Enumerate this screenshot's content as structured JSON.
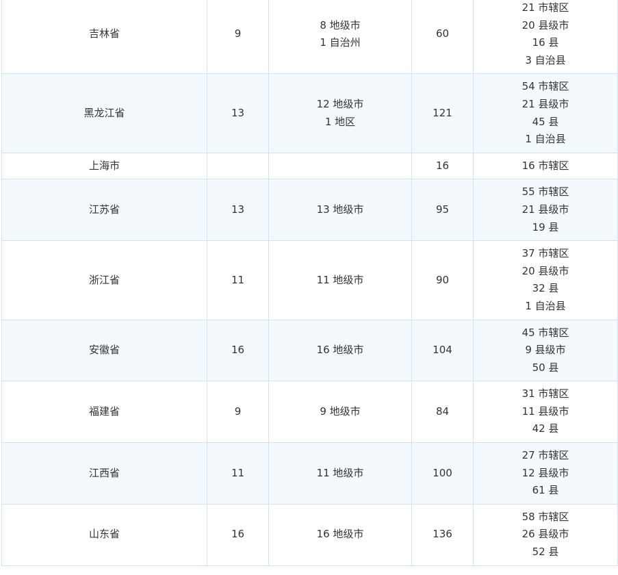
{
  "table": {
    "rows": [
      {
        "province": "吉林省",
        "prefecture_count": "9",
        "prefecture_types": [
          "8 地级市",
          "1 自治州"
        ],
        "county_count": "60",
        "county_types": [
          "21 市辖区",
          "20 县级市",
          "16 县",
          "3 自治县"
        ]
      },
      {
        "province": "黑龙江省",
        "prefecture_count": "13",
        "prefecture_types": [
          "12 地级市",
          "1 地区"
        ],
        "county_count": "121",
        "county_types": [
          "54 市辖区",
          "21 县级市",
          "45 县",
          "1 自治县"
        ]
      },
      {
        "province": "上海市",
        "prefecture_count": "",
        "prefecture_types": [],
        "county_count": "16",
        "county_types": [
          "16 市辖区"
        ]
      },
      {
        "province": "江苏省",
        "prefecture_count": "13",
        "prefecture_types": [
          "13 地级市"
        ],
        "county_count": "95",
        "county_types": [
          "55 市辖区",
          "21 县级市",
          "19 县"
        ]
      },
      {
        "province": "浙江省",
        "prefecture_count": "11",
        "prefecture_types": [
          "11 地级市"
        ],
        "county_count": "90",
        "county_types": [
          "37 市辖区",
          "20 县级市",
          "32 县",
          "1 自治县"
        ]
      },
      {
        "province": "安徽省",
        "prefecture_count": "16",
        "prefecture_types": [
          "16 地级市"
        ],
        "county_count": "104",
        "county_types": [
          "45 市辖区",
          "9 县级市",
          "50 县"
        ]
      },
      {
        "province": "福建省",
        "prefecture_count": "9",
        "prefecture_types": [
          "9 地级市"
        ],
        "county_count": "84",
        "county_types": [
          "31 市辖区",
          "11 县级市",
          "42 县"
        ]
      },
      {
        "province": "江西省",
        "prefecture_count": "11",
        "prefecture_types": [
          "11 地级市"
        ],
        "county_count": "100",
        "county_types": [
          "27 市辖区",
          "12 县级市",
          "61 县"
        ]
      },
      {
        "province": "山东省",
        "prefecture_count": "16",
        "prefecture_types": [
          "16 地级市"
        ],
        "county_count": "136",
        "county_types": [
          "58 市辖区",
          "26 县级市",
          "52 县"
        ]
      }
    ]
  },
  "colors": {
    "border": "#cfe3f3",
    "row_alt_background": "#f4f9fd",
    "text": "#333333"
  }
}
